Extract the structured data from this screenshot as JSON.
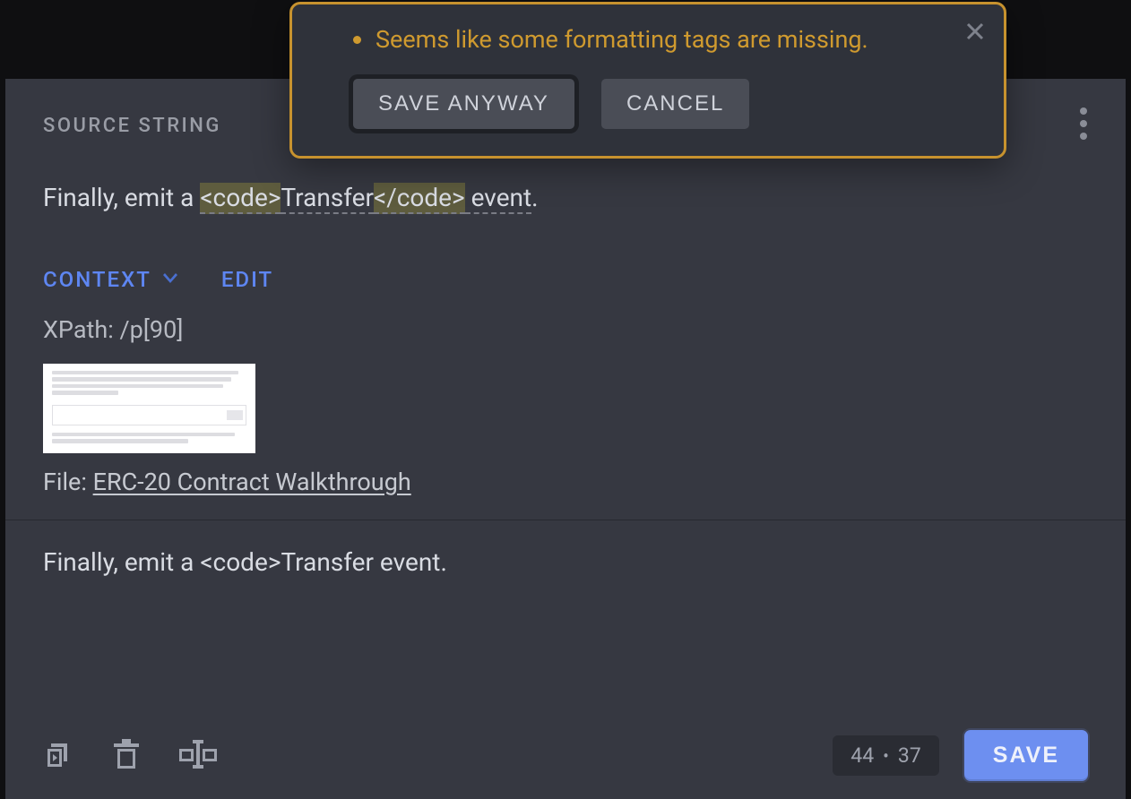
{
  "sourceSection": {
    "label": "SOURCE STRING",
    "text": {
      "pre": "Finally, emit a ",
      "tagOpen": "<code>",
      "inner": "Transfer",
      "tagClose": "</code>",
      "post": " event",
      "period": "."
    }
  },
  "context": {
    "contextLabel": "CONTEXT",
    "editLabel": "EDIT",
    "xpathLabel": "XPath: ",
    "xpathValue": "/p[90]",
    "fileLabel": "File: ",
    "fileName": "ERC-20 Contract Walkthrough"
  },
  "translation": {
    "text": "Finally, emit a <code>Transfer event."
  },
  "bottomBar": {
    "countLeft": "44",
    "countRight": "37",
    "saveLabel": "SAVE"
  },
  "modal": {
    "message": "Seems like some formatting tags are missing.",
    "saveAnyway": "SAVE ANYWAY",
    "cancel": "CANCEL"
  }
}
